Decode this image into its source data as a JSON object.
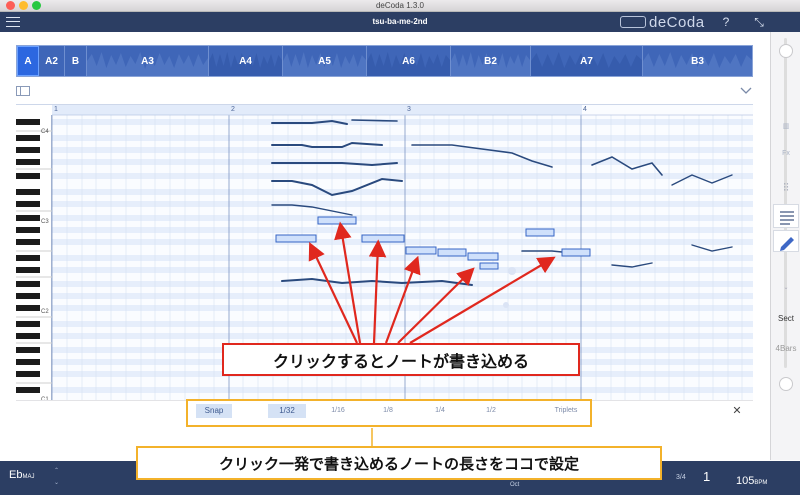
{
  "window": {
    "title": "deCoda 1.3.0"
  },
  "toolbar": {
    "document_name": "tsu-ba-me-2nd",
    "brand": "deCoda",
    "help_label": "?",
    "expand_label": "⤡"
  },
  "sections": [
    {
      "label": "A",
      "active": true
    },
    {
      "label": "A2",
      "active": false
    },
    {
      "label": "B",
      "active": false
    },
    {
      "label": "A3",
      "active": false
    },
    {
      "label": "A4",
      "active": false
    },
    {
      "label": "A5",
      "active": false
    },
    {
      "label": "A6",
      "active": false
    },
    {
      "label": "B2",
      "active": false
    },
    {
      "label": "A7",
      "active": false
    },
    {
      "label": "B3",
      "active": false
    }
  ],
  "timeline": {
    "bar_markers": [
      "1",
      "2",
      "3",
      "4"
    ]
  },
  "keyboard": {
    "octave_labels": [
      "C4",
      "C3",
      "C2",
      "C1"
    ]
  },
  "right_panel": {
    "fx_label": "Fx",
    "section_label": "Sect",
    "bars_label": "4Bars"
  },
  "quantize": {
    "snap_label": "Snap",
    "options": [
      "1/32",
      "1/16",
      "1/8",
      "1/4",
      "1/2",
      "Triplets"
    ],
    "selected": "1/32",
    "close_label": "✕"
  },
  "bottom": {
    "key": "Eb",
    "key_mode": "MAJ",
    "oct_label": "Oct",
    "time_signature": "3/4",
    "bar_position": "1",
    "tempo": "105",
    "tempo_unit": "BPM"
  },
  "annotations": {
    "click_note": "クリックするとノートが書き込める",
    "note_length": "クリック一発で書き込めるノートの長さをココで設定"
  },
  "colors": {
    "accent": "#2c67e0",
    "dark_bar": "#2c3e63",
    "annotation_red": "#e0281e",
    "annotation_orange": "#f3b22b"
  }
}
